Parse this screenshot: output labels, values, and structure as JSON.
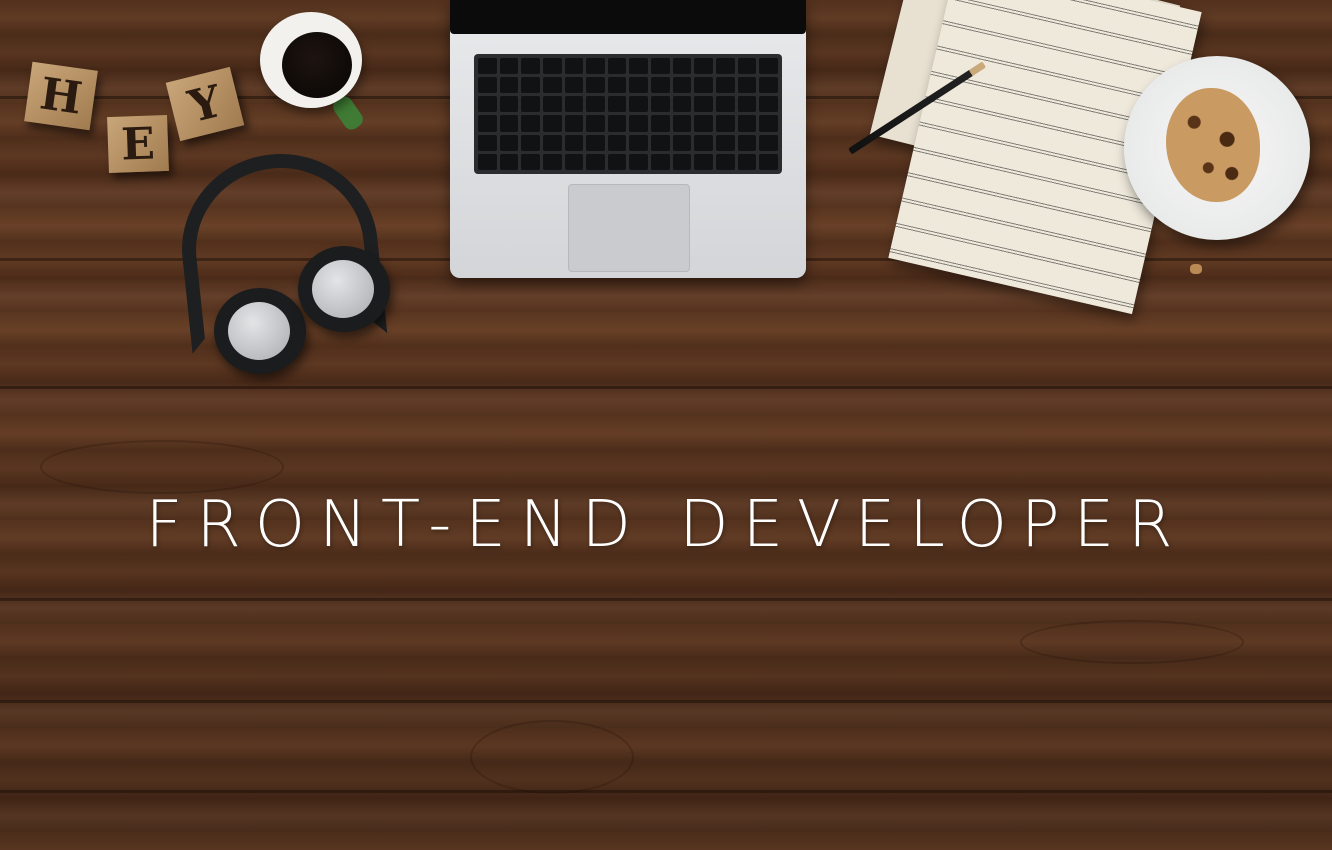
{
  "scene": {
    "headline": "Front-end Developer",
    "blocks": {
      "h": "H",
      "e": "E",
      "y": "Y"
    }
  },
  "colors": {
    "wood": "#5b3620",
    "text": "#ffffff",
    "cup_handle": "#3f7b34"
  }
}
